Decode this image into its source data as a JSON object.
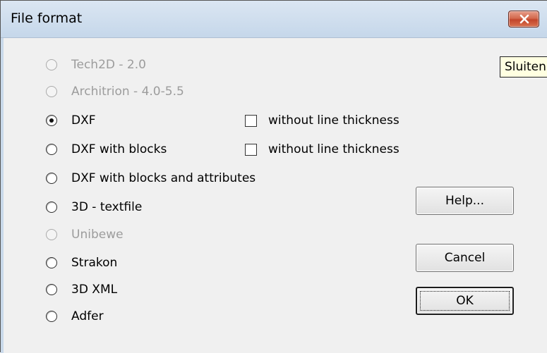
{
  "window": {
    "title": "File format"
  },
  "formats": [
    {
      "label": "Tech2D - 2.0",
      "selected": false,
      "enabled": false
    },
    {
      "label": "Architrion - 4.0-5.5",
      "selected": false,
      "enabled": false
    },
    {
      "label": "DXF",
      "selected": true,
      "enabled": true
    },
    {
      "label": "DXF with blocks",
      "selected": false,
      "enabled": true
    },
    {
      "label": "DXF with blocks and attributes",
      "selected": false,
      "enabled": true
    },
    {
      "label": "3D - textfile",
      "selected": false,
      "enabled": true
    },
    {
      "label": "Unibewe",
      "selected": false,
      "enabled": false
    },
    {
      "label": "Strakon",
      "selected": false,
      "enabled": true
    },
    {
      "label": "3D XML",
      "selected": false,
      "enabled": true
    },
    {
      "label": "Adfer",
      "selected": false,
      "enabled": true
    }
  ],
  "options": [
    {
      "label": "without line thickness",
      "checked": false
    },
    {
      "label": "without line thickness",
      "checked": false
    }
  ],
  "buttons": {
    "help": "Help...",
    "cancel": "Cancel",
    "ok": "OK"
  },
  "tooltip": {
    "text": "Sluiten"
  },
  "colors": {
    "close_button": "#c2452b",
    "disabled_text": "#9c9c9c",
    "tooltip_bg": "#ffffe1"
  }
}
